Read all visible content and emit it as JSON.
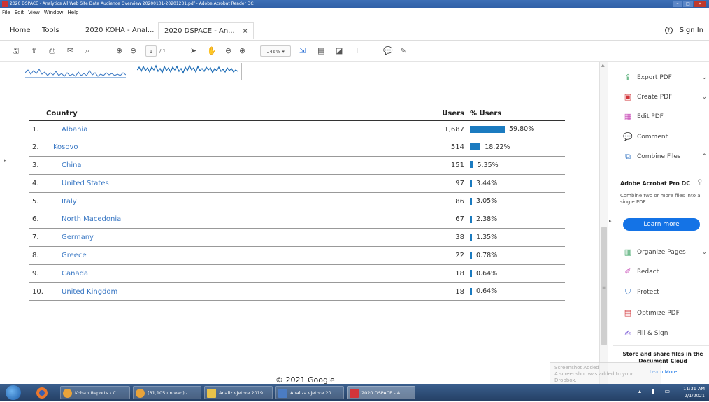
{
  "window": {
    "title": "2020 DSPACE - Analytics All Web Site Data Audience Overview 20200101-20201231.pdf - Adobe Acrobat Reader DC",
    "menu": [
      "File",
      "Edit",
      "View",
      "Window",
      "Help"
    ]
  },
  "tabs": {
    "home": "Home",
    "tools": "Tools",
    "tab1": "2020 KOHA - Anal...",
    "tab2": "2020 DSPACE - An...",
    "tab2_close": "×",
    "sign_in": "Sign In"
  },
  "toolbar": {
    "page_current": "1",
    "page_total": "/ 1",
    "zoom": "146%"
  },
  "report": {
    "col_country": "Country",
    "col_users": "Users",
    "col_pct": "% Users",
    "rows": [
      {
        "rank": "1.",
        "country": "Albania",
        "users": "1,687",
        "pct": "59.80%",
        "share": 59.8
      },
      {
        "rank": "2.",
        "country": "Kosovo",
        "users": "514",
        "pct": "18.22%",
        "share": 18.22
      },
      {
        "rank": "3.",
        "country": "China",
        "users": "151",
        "pct": "5.35%",
        "share": 5.35
      },
      {
        "rank": "4.",
        "country": "United States",
        "users": "97",
        "pct": "3.44%",
        "share": 3.44
      },
      {
        "rank": "5.",
        "country": "Italy",
        "users": "86",
        "pct": "3.05%",
        "share": 3.05
      },
      {
        "rank": "6.",
        "country": "North Macedonia",
        "users": "67",
        "pct": "2.38%",
        "share": 2.38
      },
      {
        "rank": "7.",
        "country": "Germany",
        "users": "38",
        "pct": "1.35%",
        "share": 1.35
      },
      {
        "rank": "8.",
        "country": "Greece",
        "users": "22",
        "pct": "0.78%",
        "share": 0.78
      },
      {
        "rank": "9.",
        "country": "Canada",
        "users": "18",
        "pct": "0.64%",
        "share": 0.64
      },
      {
        "rank": "10.",
        "country": "United Kingdom",
        "users": "18",
        "pct": "0.64%",
        "share": 0.64
      }
    ],
    "footer": "© 2021 Google"
  },
  "right_panel": {
    "export_pdf": "Export PDF",
    "create_pdf": "Create PDF",
    "edit_pdf": "Edit PDF",
    "comment": "Comment",
    "combine_files": "Combine Files",
    "promo_title": "Adobe Acrobat Pro DC",
    "promo_text": "Combine two or more files into a single PDF",
    "learn_more": "Learn more",
    "organize_pages": "Organize Pages",
    "redact": "Redact",
    "protect": "Protect",
    "optimize_pdf": "Optimize PDF",
    "fill_sign": "Fill & Sign",
    "store_text": "Store and share files in the Document Cloud",
    "learn_more_link": "Learn More"
  },
  "toast": {
    "title": "Screenshot Added",
    "text": "A screenshot was added to your Dropbox."
  },
  "taskbar": {
    "tasks": [
      "Koha › Reports › C...",
      "(31,105 unread) - ...",
      "Analiz vjetore 2019",
      "Analiza vjetore 20...",
      "2020 DSPACE - A..."
    ],
    "time": "11:31 AM",
    "date": "2/1/2021"
  },
  "colors": {
    "bar": "#1b7bc0",
    "link": "#3a78c4",
    "accent": "#1473e6"
  }
}
